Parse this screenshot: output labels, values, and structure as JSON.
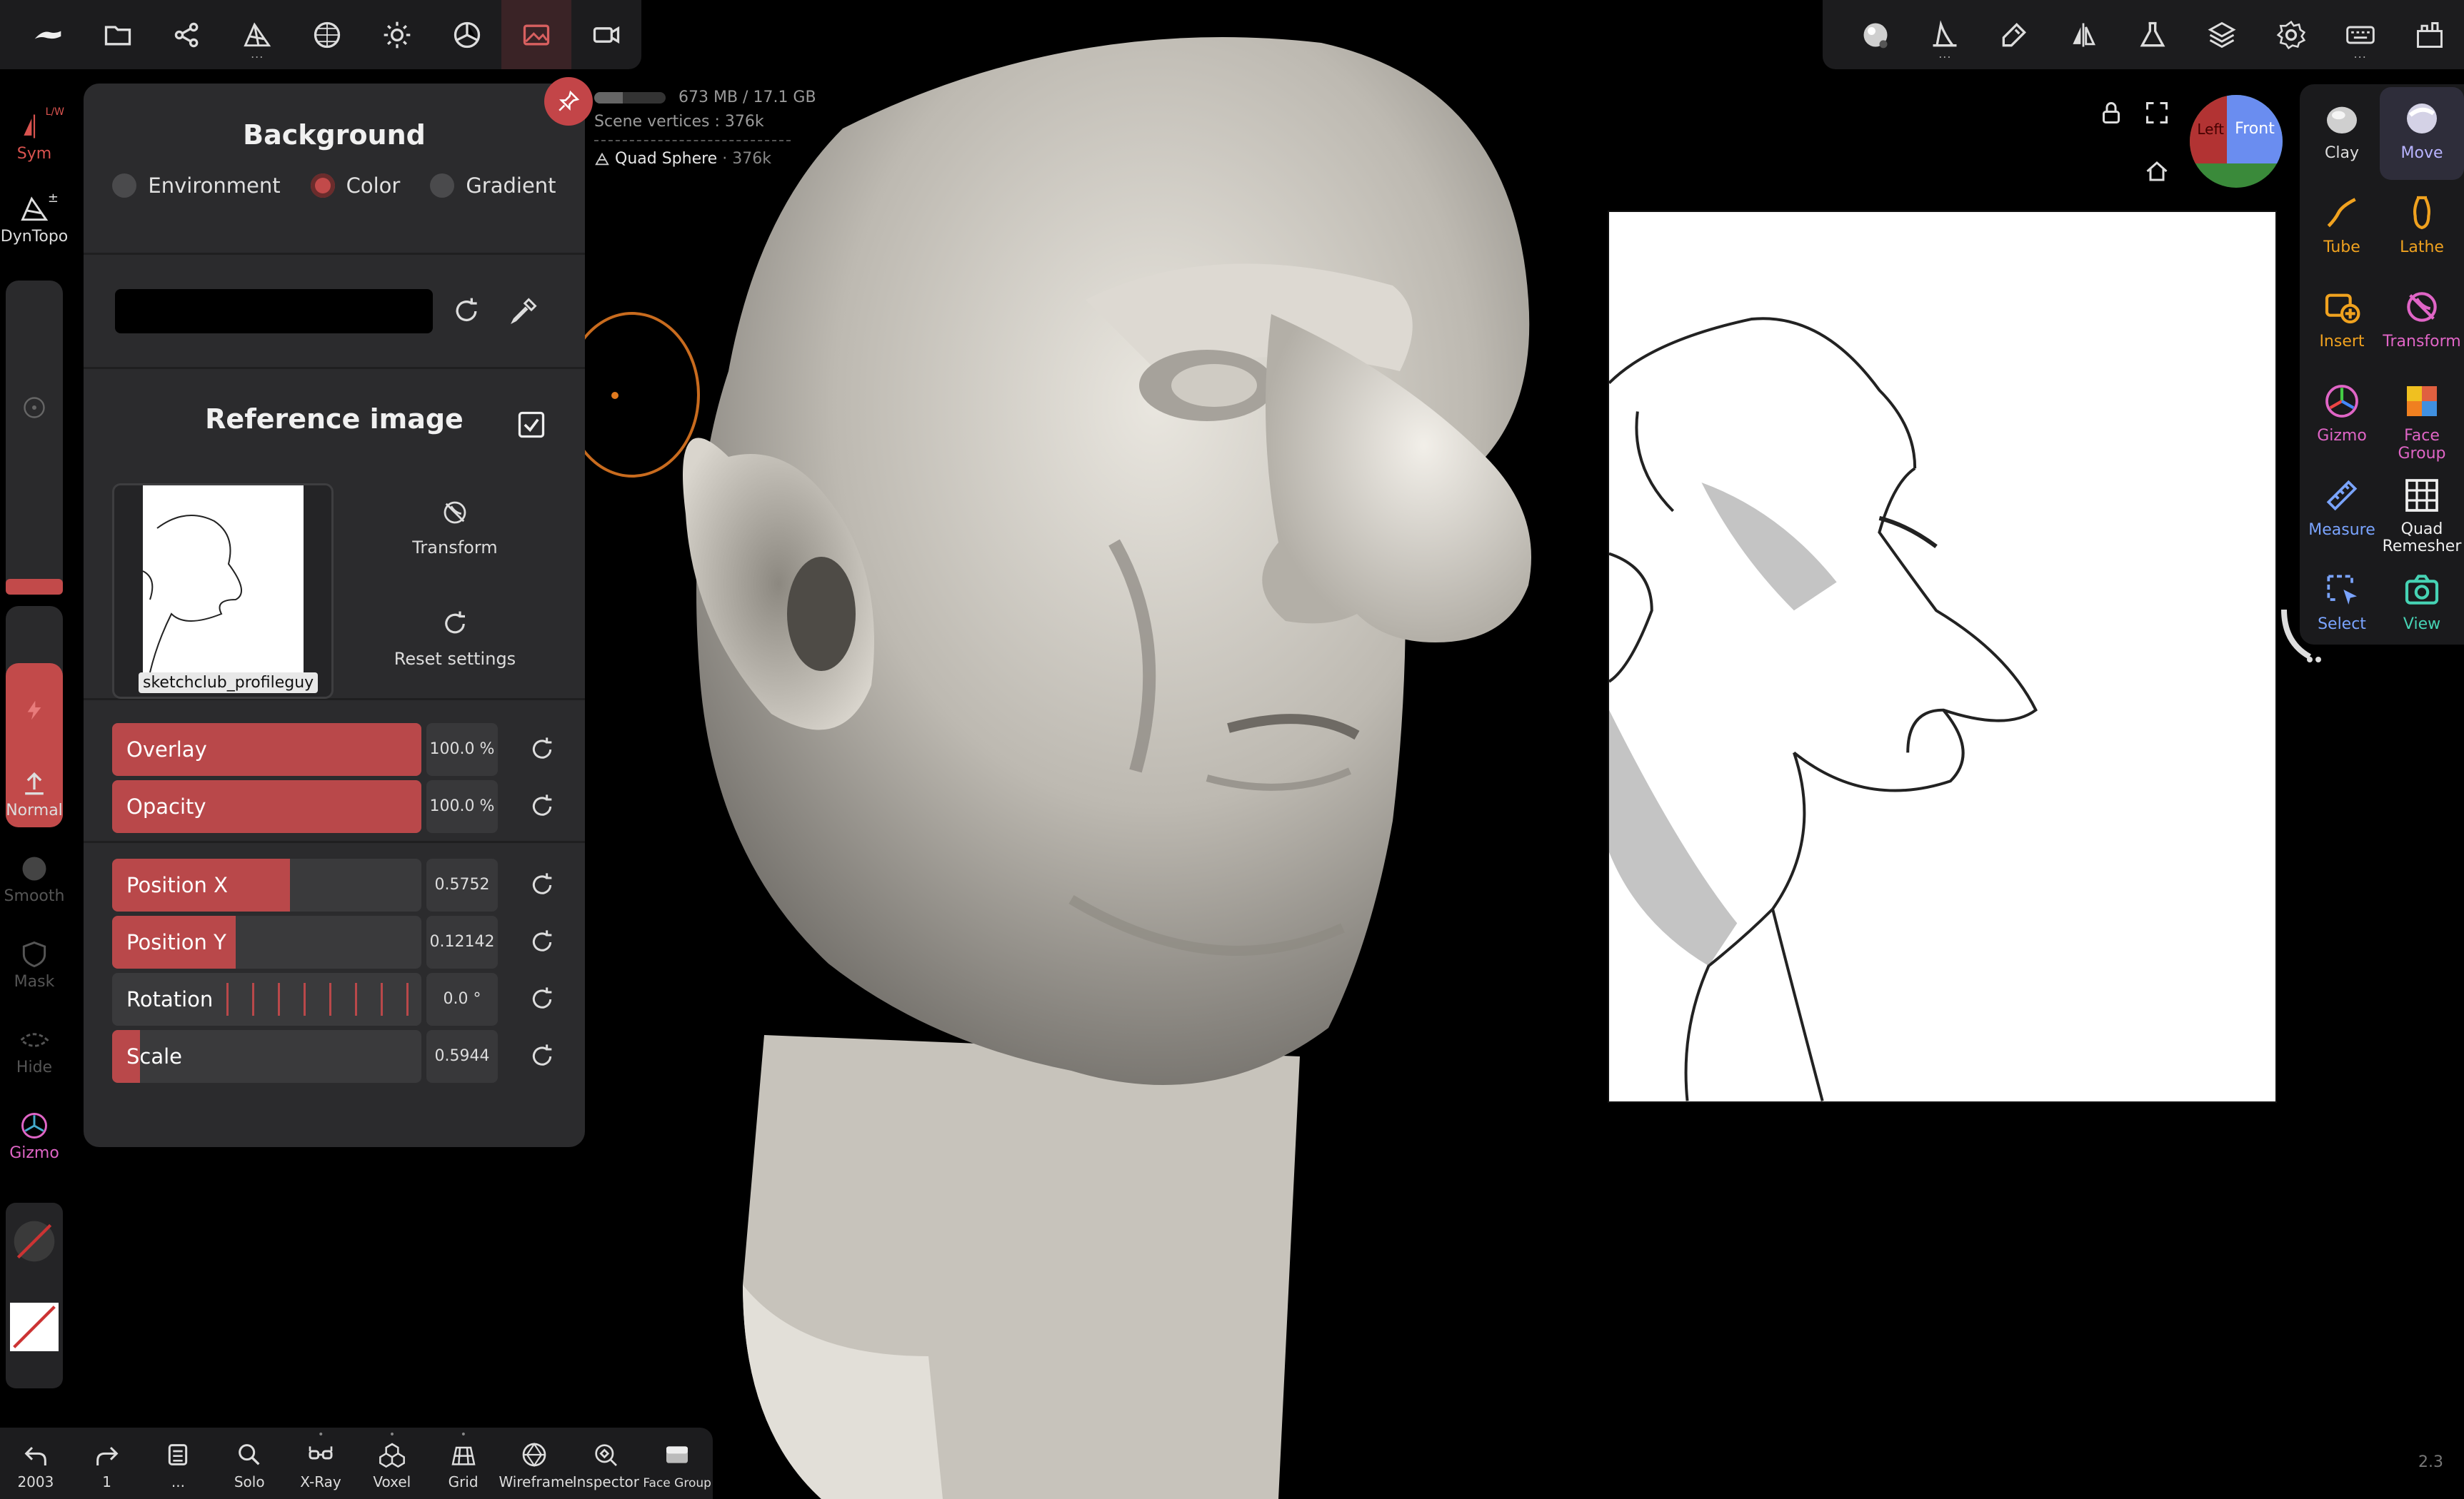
{
  "top_left_toolbar": [
    {
      "name": "app-menu-icon",
      "active": false
    },
    {
      "name": "folder-icon",
      "active": false
    },
    {
      "name": "scene-graph-icon",
      "active": false
    },
    {
      "name": "topology-icon",
      "active": false,
      "dots": "..."
    },
    {
      "name": "material-sphere-icon",
      "active": false
    },
    {
      "name": "light-icon",
      "active": false
    },
    {
      "name": "shading-icon",
      "active": false
    },
    {
      "name": "background-image-icon",
      "active": true
    },
    {
      "name": "camera-icon",
      "active": false
    }
  ],
  "top_right_toolbar": [
    {
      "name": "matcap-icon"
    },
    {
      "name": "stroke-curve-icon",
      "dots": "..."
    },
    {
      "name": "brush-settings-icon"
    },
    {
      "name": "symmetry-icon"
    },
    {
      "name": "flask-icon"
    },
    {
      "name": "layers-icon"
    },
    {
      "name": "settings-gear-icon"
    },
    {
      "name": "keyboard-icon",
      "dots": "..."
    },
    {
      "name": "gallery-icon"
    }
  ],
  "left_bar": {
    "sym_label": "Sym",
    "sym_badge": "L/W",
    "dyntopo_label": "DynTopo",
    "dyntopo_badge": "±",
    "normal_label": "Normal",
    "smooth_label": "Smooth",
    "mask_label": "Mask",
    "hide_label": "Hide",
    "gizmo_label": "Gizmo"
  },
  "background_panel": {
    "title": "Background",
    "options": [
      "Environment",
      "Color",
      "Gradient"
    ],
    "selected": "Color",
    "color_value": "#000000",
    "reference_title": "Reference image",
    "reference_enabled": true,
    "thumb_name": "sketchclub_profileguy",
    "transform_label": "Transform",
    "reset_label": "Reset settings",
    "sliders": {
      "overlay": {
        "label": "Overlay",
        "value": "100.0 %",
        "fill": 1.0
      },
      "opacity": {
        "label": "Opacity",
        "value": "100.0 %",
        "fill": 1.0
      },
      "position_x": {
        "label": "Position X",
        "value": "0.5752",
        "fill": 0.5752
      },
      "position_y": {
        "label": "Position Y",
        "value": "0.12142",
        "fill": 0.4
      },
      "rotation": {
        "label": "Rotation",
        "value": "0.0 °"
      },
      "scale": {
        "label": "Scale",
        "value": "0.5944",
        "fill": 0.09
      }
    }
  },
  "scene_info": {
    "memory": "673 MB / 17.1 GB",
    "vertices": "Scene vertices : 376k",
    "mesh_name": "Quad Sphere",
    "mesh_verts": " · 376k"
  },
  "nav_cube": {
    "left": "Left",
    "front": "Front"
  },
  "right_tools": [
    {
      "key": "clay",
      "label": "Clay",
      "color": "#d0d0d0",
      "active": false
    },
    {
      "key": "move",
      "label": "Move",
      "color": "#b9b4ff",
      "active": true
    },
    {
      "key": "tube",
      "label": "Tube",
      "color": "#f0a21f"
    },
    {
      "key": "lathe",
      "label": "Lathe",
      "color": "#f0a21f"
    },
    {
      "key": "insert",
      "label": "Insert",
      "color": "#f0a21f"
    },
    {
      "key": "transform",
      "label": "Transform",
      "color": "#e065c6"
    },
    {
      "key": "gizmo",
      "label": "Gizmo",
      "color": "#e065c6"
    },
    {
      "key": "face-group",
      "label": "Face Group",
      "color": "#e065c6"
    },
    {
      "key": "measure",
      "label": "Measure",
      "color": "#7aa4ff"
    },
    {
      "key": "quad-remesher",
      "label": "Quad Remesher",
      "color": "#e6e6e6"
    },
    {
      "key": "select",
      "label": "Select",
      "color": "#7aa4ff"
    },
    {
      "key": "view",
      "label": "View",
      "color": "#46d3b4"
    }
  ],
  "bottom_bar": [
    {
      "key": "undo",
      "label": "2003"
    },
    {
      "key": "redo",
      "label": "1"
    },
    {
      "key": "history",
      "label": "..."
    },
    {
      "key": "solo",
      "label": "Solo"
    },
    {
      "key": "xray",
      "label": "X-Ray"
    },
    {
      "key": "voxel",
      "label": "Voxel"
    },
    {
      "key": "grid",
      "label": "Grid"
    },
    {
      "key": "wireframe",
      "label": "Wireframe"
    },
    {
      "key": "inspector",
      "label": "Inspector"
    },
    {
      "key": "face-group",
      "label": "Face Group"
    }
  ],
  "version": "2.3"
}
